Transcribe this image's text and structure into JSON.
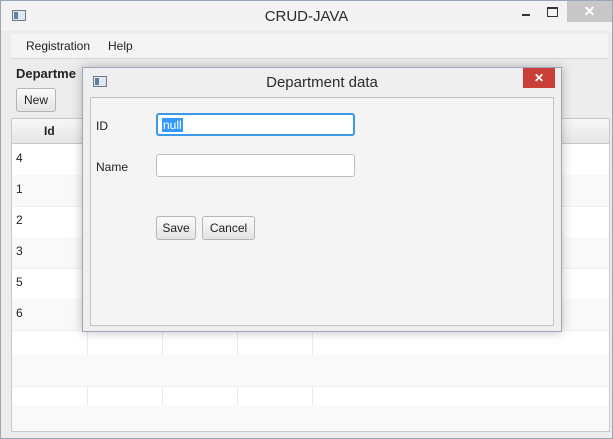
{
  "window": {
    "title": "CRUD-JAVA",
    "close_glyph": "✕"
  },
  "menu": {
    "items": [
      "Registration",
      "Help"
    ]
  },
  "page": {
    "section_title": "Departme",
    "new_label": "New"
  },
  "table": {
    "columns": [
      "Id"
    ],
    "ids": [
      "4",
      "1",
      "2",
      "3",
      "5",
      "6"
    ]
  },
  "dialog": {
    "title": "Department data",
    "close_glyph": "✕",
    "id_label": "ID",
    "id_value": "null",
    "name_label": "Name",
    "name_value": "",
    "save_label": "Save",
    "cancel_label": "Cancel"
  },
  "colors": {
    "close_button": "#c9403a",
    "focus_border": "#3a9ae8",
    "selection": "#3399ff"
  },
  "icons": [
    "app-window-icon",
    "minimize-icon",
    "maximize-icon",
    "close-icon"
  ]
}
